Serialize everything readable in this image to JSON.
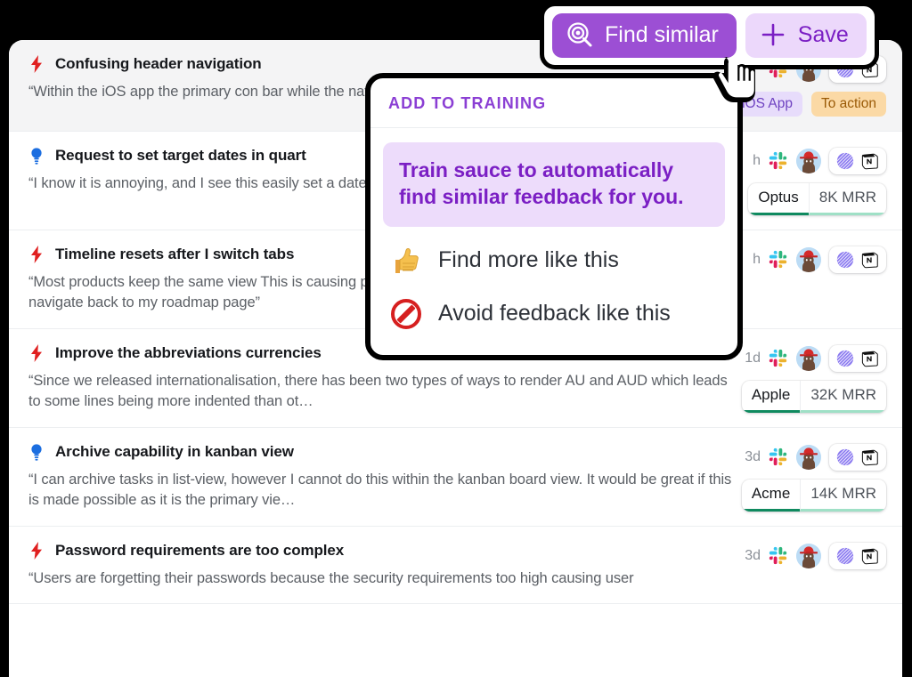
{
  "action_bar": {
    "find_similar_label": "Find similar",
    "find_similar_icon": "target-search-icon",
    "save_label": "Save",
    "save_icon": "plus-icon",
    "primary_color": "#9c4fd4",
    "secondary_bg": "#ecd8fb",
    "secondary_color": "#7b1fc4"
  },
  "popover": {
    "header": "ADD TO TRAINING",
    "banner": "Train sauce to automatically find similar feedback for you.",
    "items": [
      {
        "label": "Find more like this",
        "icon": "thumbs-up-icon"
      },
      {
        "label": "Avoid feedback like this",
        "icon": "no-entry-icon"
      }
    ],
    "accent_color": "#8b3fd4",
    "banner_bg": "#eddcfb"
  },
  "cursor": {
    "icon": "pointing-hand-cursor"
  },
  "feedback_rows": [
    {
      "type_icon": "bolt-icon",
      "type_color": "#e02020",
      "title": "Confusing header navigation",
      "quote": "“Within the iOS app the primary con                 bar while the navigation links are pla",
      "time": "",
      "selected": true,
      "chips": [
        {
          "label": "iOS App",
          "style": "purple"
        },
        {
          "label": "To action",
          "style": "orange"
        }
      ],
      "integrations": [
        "slack-icon",
        "avatar",
        "linear-icon",
        "notion-icon"
      ],
      "pill": null
    },
    {
      "type_icon": "lightbulb-icon",
      "type_color": "#1c6ee0",
      "title": "Request to set target dates in quart",
      "quote": "“I know it is annoying, and I see this                 easily set a date as Q1 or Q2 within",
      "time": "h",
      "selected": false,
      "chips": [],
      "integrations": [
        "slack-icon",
        "avatar",
        "linear-icon",
        "notion-icon"
      ],
      "pill": {
        "name": "Optus",
        "mrr": "8K MRR"
      }
    },
    {
      "type_icon": "bolt-icon",
      "type_color": "#e02020",
      "title": "Timeline resets after I switch tabs",
      "quote": "“Most products keep the same view                   This is causing problems as I have to keep resetting filters every time I navigate back to my roadmap page”",
      "time": "h",
      "selected": false,
      "chips": [],
      "integrations": [
        "slack-icon",
        "avatar",
        "linear-icon",
        "notion-icon"
      ],
      "pill": null
    },
    {
      "type_icon": "bolt-icon",
      "type_color": "#e02020",
      "title": "Improve the abbreviations currencies",
      "quote": "“Since we released internationalisation, there has been two types of ways to render AU and AUD which leads to some lines being more indented than ot…",
      "time": "1d",
      "selected": false,
      "chips": [],
      "integrations": [
        "slack-icon",
        "avatar",
        "linear-icon",
        "notion-icon"
      ],
      "pill": {
        "name": "Apple",
        "mrr": "32K MRR"
      }
    },
    {
      "type_icon": "lightbulb-icon",
      "type_color": "#1c6ee0",
      "title": "Archive capability in kanban view",
      "quote": "“I can archive tasks in list-view, however I cannot do this within the kanban board view. It would be great if this is made possible as it is the primary vie…",
      "time": "3d",
      "selected": false,
      "chips": [],
      "integrations": [
        "slack-icon",
        "avatar",
        "linear-icon",
        "notion-icon"
      ],
      "pill": {
        "name": "Acme",
        "mrr": "14K MRR"
      }
    },
    {
      "type_icon": "bolt-icon",
      "type_color": "#e02020",
      "title": "Password requirements are too complex",
      "quote": "“Users are forgetting their passwords because the security requirements too high causing user",
      "time": "3d",
      "selected": false,
      "chips": [],
      "integrations": [
        "slack-icon",
        "avatar",
        "linear-icon",
        "notion-icon"
      ],
      "pill": null
    }
  ]
}
